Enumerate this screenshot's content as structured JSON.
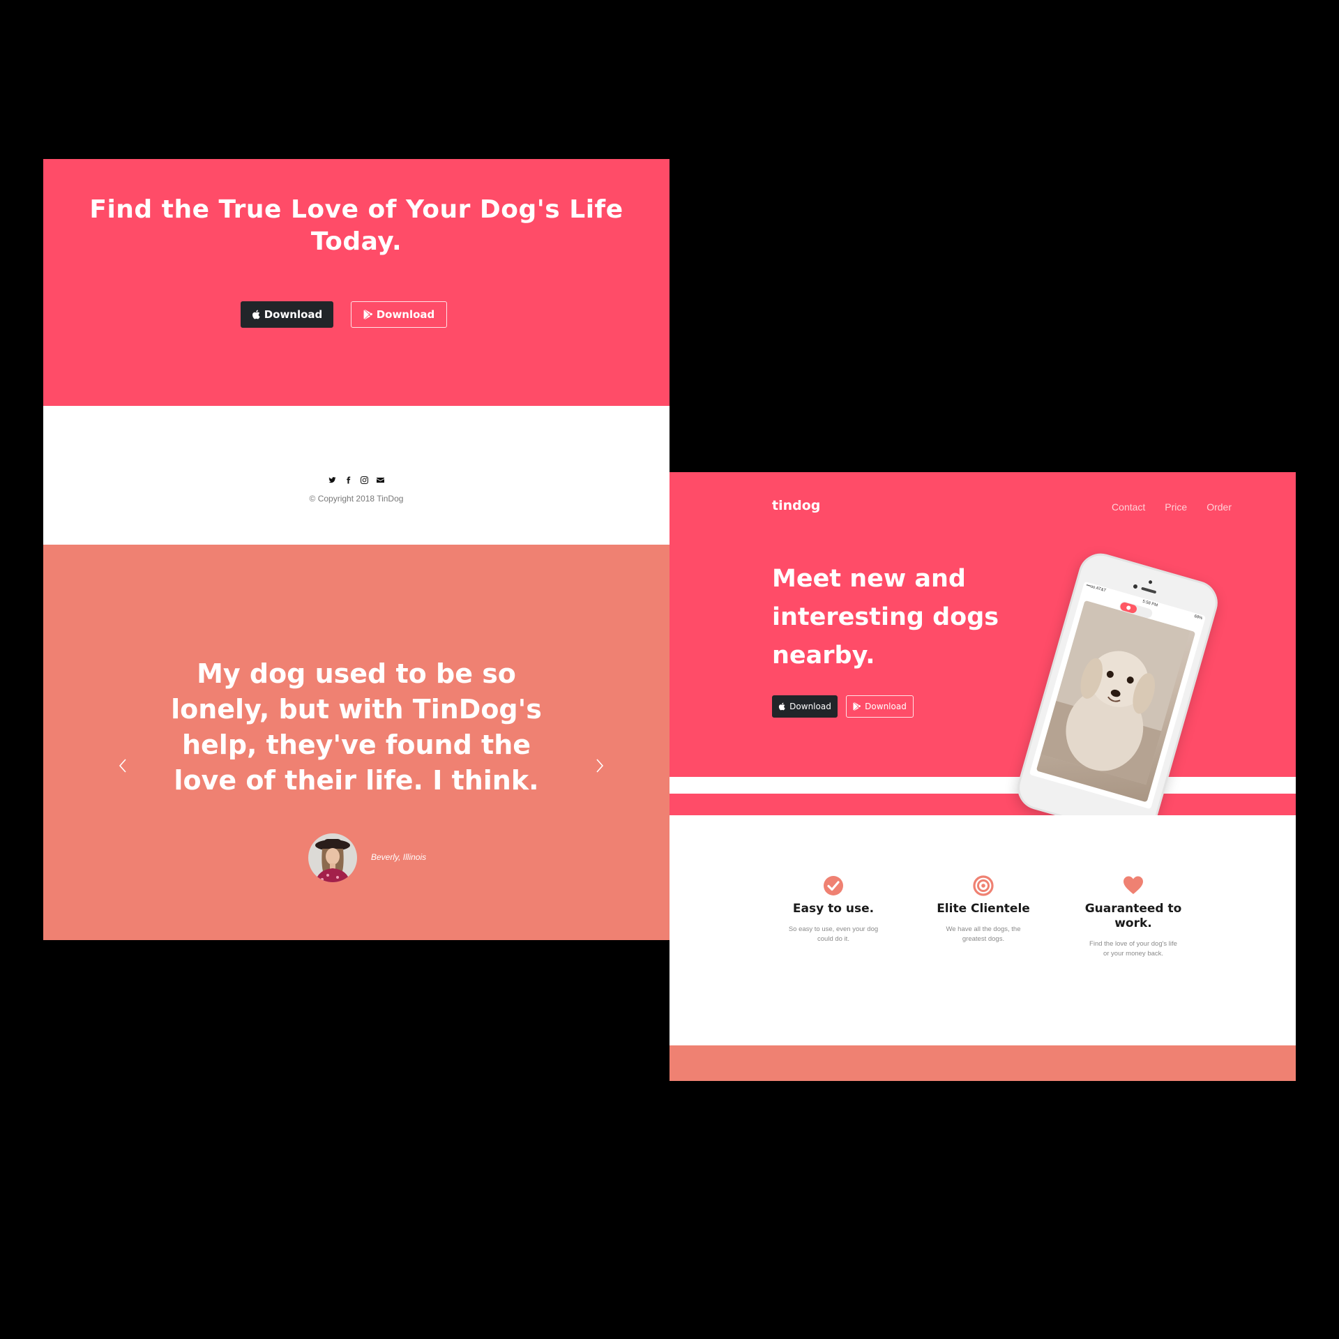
{
  "left": {
    "cta": {
      "title": "Find the True Love of Your Dog's Life Today.",
      "apple_button": "Download",
      "google_button": "Download"
    },
    "footer": {
      "icons": [
        "twitter-icon",
        "facebook-icon",
        "instagram-icon",
        "envelope-icon"
      ],
      "copyright": "© Copyright 2018 TinDog"
    },
    "testimonial": {
      "quote": "My dog used to be so lonely, but with TinDog's help, they've found the love of their life. I think.",
      "author": "Beverly, Illinois"
    }
  },
  "right": {
    "nav": {
      "brand": "tindog",
      "links": [
        "Contact",
        "Price",
        "Order"
      ]
    },
    "hero": {
      "title": "Meet new and interesting dogs nearby.",
      "apple_button": "Download",
      "google_button": "Download"
    },
    "phone": {
      "carrier": "•••oo AT&T",
      "time": "5:58 PM",
      "battery": "68%"
    },
    "features": [
      {
        "icon": "check-circle-icon",
        "title": "Easy to use.",
        "text": "So easy to use, even your dog could do it."
      },
      {
        "icon": "bullseye-icon",
        "title": "Elite Clientele",
        "text": "We have all the dogs, the greatest dogs."
      },
      {
        "icon": "heart-icon",
        "title": "Guaranteed to work.",
        "text": "Find the love of your dog's life or your money back."
      }
    ]
  },
  "colors": {
    "primary": "#ff4c68",
    "coral": "#ef8172",
    "dark": "#212529",
    "background": "#000000"
  }
}
